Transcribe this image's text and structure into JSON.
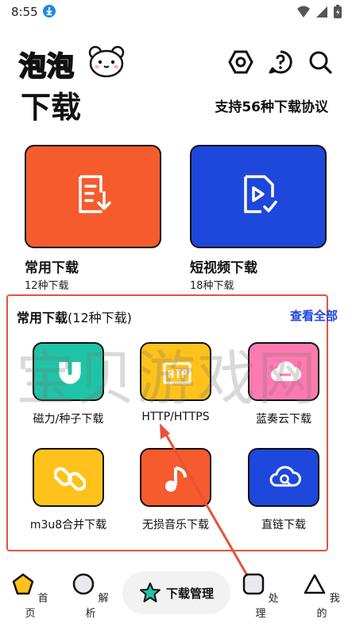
{
  "status_bar": {
    "time": "8:55"
  },
  "header": {
    "logo_word": "泡泡",
    "title": "下载",
    "subtitle": "支持56种下载协议",
    "icons": [
      "settings-icon",
      "help-icon",
      "search-icon"
    ]
  },
  "cards": [
    {
      "title": "常用下载",
      "sub": "12种下载",
      "color": "#f55b2d",
      "icon": "download-list-icon"
    },
    {
      "title": "短视频下载",
      "sub": "18种下载",
      "color": "#1e47db",
      "icon": "video-file-icon"
    }
  ],
  "panel": {
    "title_bold": "常用下载",
    "title_rest": "(12种下载)",
    "view_all": "查看全部",
    "items": [
      {
        "label": "磁力/种子下载",
        "color": "#1fc4a6",
        "icon": "magnet-icon"
      },
      {
        "label": "HTTP/HTTPS",
        "color": "#ffc21a",
        "icon": "http-icon"
      },
      {
        "label": "蓝奏云下载",
        "color": "#ff7ab0",
        "icon": "cloud-icon"
      },
      {
        "label": "m3u8合并下载",
        "color": "#ffc21a",
        "icon": "link-icon"
      },
      {
        "label": "无损音乐下载",
        "color": "#f55b2d",
        "icon": "music-note-icon"
      },
      {
        "label": "直链下载",
        "color": "#1e47db",
        "icon": "cloud-search-icon"
      }
    ]
  },
  "watermark": "宝贝游戏网",
  "bottom_nav": {
    "home": "首页",
    "parse": "解析",
    "center": "下载管理",
    "process": "处理",
    "mine": "我的"
  },
  "colors": {
    "accent_red": "#e2543b",
    "accent_blue": "#1e47db",
    "annotation_arrow": "#e2543b"
  }
}
